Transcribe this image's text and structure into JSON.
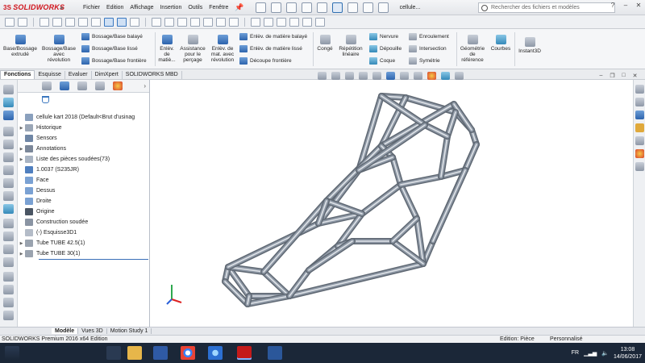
{
  "app": {
    "logo_prefix": "3S",
    "logo": "SOLIDWORKS",
    "doc_title": "cellule...",
    "search_placeholder": "Rechercher des fichiers et modèles"
  },
  "menus": [
    "Fichier",
    "Edition",
    "Affichage",
    "Insertion",
    "Outils",
    "Fenêtre"
  ],
  "ribbon": {
    "big": [
      {
        "label1": "Base/Bossage",
        "label2": "extrudé"
      },
      {
        "label1": "Bossage/Base",
        "label2": "avec",
        "label3": "révolution"
      },
      {
        "label1": "Enlèv.",
        "label2": "de",
        "label3": "matiè..."
      },
      {
        "label1": "Assistance",
        "label2": "pour le",
        "label3": "perçage"
      },
      {
        "label1": "Enlèv. de",
        "label2": "mat. avec",
        "label3": "révolution"
      }
    ],
    "small_left": [
      "Bossage/Base balayé",
      "Bossage/Base lissé",
      "Bossage/Base frontière"
    ],
    "small_mid": [
      "Enlèv. de matière balayé",
      "Enlèv. de matière lissé",
      "Découpe frontière"
    ],
    "conge": "Congé",
    "repetition": {
      "l1": "Répétition",
      "l2": "linéaire"
    },
    "col3": [
      "Nervure",
      "Dépouille",
      "Coque"
    ],
    "col4": [
      "Enroulement",
      "Intersection",
      "Symétrie"
    ],
    "geometrie": {
      "l1": "Géométrie",
      "l2": "de",
      "l3": "référence"
    },
    "courbes": "Courbes",
    "instant3d": "Instant3D"
  },
  "tabs": [
    {
      "label": "Fonctions",
      "active": true
    },
    {
      "label": "Esquisse",
      "active": false
    },
    {
      "label": "Evaluer",
      "active": false
    },
    {
      "label": "DimXpert",
      "active": false
    },
    {
      "label": "SOLIDWORKS MBD",
      "active": false
    }
  ],
  "tree": [
    {
      "label": "cellule kart 2018  (Default<Brut d'usinag",
      "exp": "",
      "icon": "part-icon",
      "color": "#8aa0bd"
    },
    {
      "label": "Historique",
      "exp": "▶",
      "icon": "history-icon",
      "color": "#9aa6b6"
    },
    {
      "label": "Sensors",
      "exp": "",
      "icon": "sensor-icon",
      "color": "#6f86a5"
    },
    {
      "label": "Annotations",
      "exp": "▶",
      "icon": "annotation-icon",
      "color": "#7b8799"
    },
    {
      "label": "Liste des pièces soudées(73)",
      "exp": "▶",
      "icon": "cutlist-icon",
      "color": "#a9b4c3"
    },
    {
      "label": "1.0037 (S235JR)",
      "exp": "",
      "icon": "material-icon",
      "color": "#4f7fbf"
    },
    {
      "label": "Face",
      "exp": "",
      "icon": "plane-icon",
      "color": "#7aa1d3"
    },
    {
      "label": "Dessus",
      "exp": "",
      "icon": "plane-icon",
      "color": "#7aa1d3"
    },
    {
      "label": "Droite",
      "exp": "",
      "icon": "plane-icon",
      "color": "#7aa1d3"
    },
    {
      "label": "Origine",
      "exp": "",
      "icon": "origin-icon",
      "color": "#4a5563"
    },
    {
      "label": "Construction soudée",
      "exp": "",
      "icon": "weldment-icon",
      "color": "#8a94a3"
    },
    {
      "label": "(-) Esquisse3D1",
      "exp": "",
      "icon": "sketch3d-icon",
      "color": "#b4bcc8"
    },
    {
      "label": "Tube TUBE 42.5(1)",
      "exp": "▶",
      "icon": "tube-icon",
      "color": "#9aa3af"
    },
    {
      "label": "Tube TUBE 30(1)",
      "exp": "▶",
      "icon": "tube-icon",
      "color": "#9aa3af"
    }
  ],
  "bottom_tabs": [
    {
      "label": "Modèle",
      "active": true
    },
    {
      "label": "Vues 3D",
      "active": false
    },
    {
      "label": "Motion Study 1",
      "active": false
    }
  ],
  "status": {
    "edition": "SOLIDWORKS Premium 2016 x64 Edition",
    "mode": "Edition: Pièce",
    "custom": "Personnalisé"
  },
  "taskbar": {
    "lang": "FR",
    "time": "13:08",
    "date": "14/06/2017"
  },
  "colors": {
    "accent": "#2f6fb1",
    "brand": "#d0141c",
    "tube": "#8f99a6",
    "taskbar": "#1b2738"
  }
}
